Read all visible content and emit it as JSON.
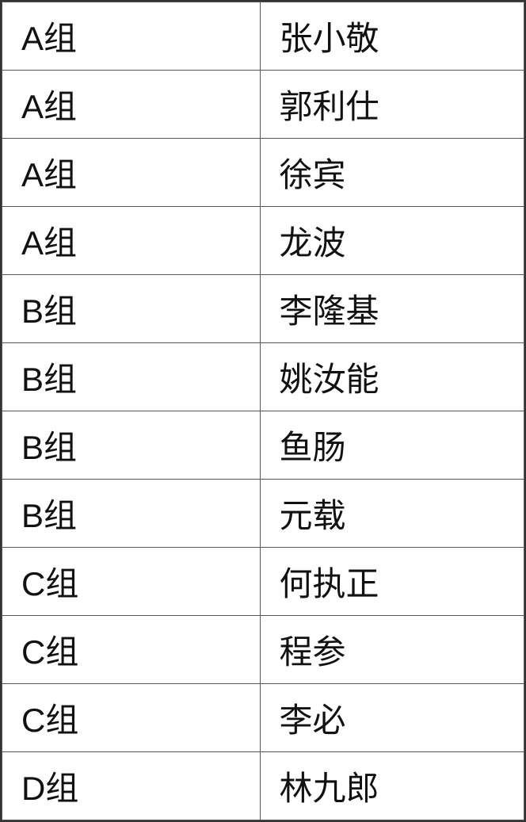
{
  "table": {
    "rows": [
      {
        "group": "A组",
        "name": "张小敬"
      },
      {
        "group": "A组",
        "name": "郭利仕"
      },
      {
        "group": "A组",
        "name": "徐宾"
      },
      {
        "group": "A组",
        "name": "龙波"
      },
      {
        "group": "B组",
        "name": "李隆基"
      },
      {
        "group": "B组",
        "name": "姚汝能"
      },
      {
        "group": "B组",
        "name": "鱼肠"
      },
      {
        "group": "B组",
        "name": "元载"
      },
      {
        "group": "C组",
        "name": "何执正"
      },
      {
        "group": "C组",
        "name": "程参"
      },
      {
        "group": "C组",
        "name": "李必"
      },
      {
        "group": "D组",
        "name": "林九郎"
      }
    ]
  }
}
